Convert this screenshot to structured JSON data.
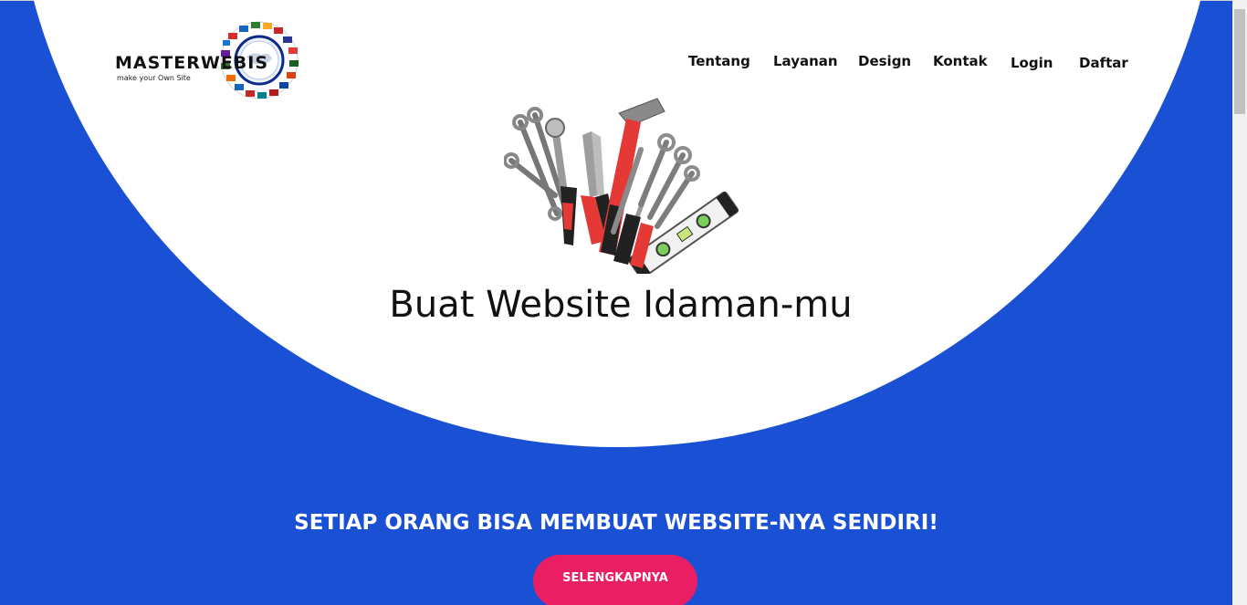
{
  "brand": {
    "name": "MASTERWEBIS",
    "tagline": "make your Own Site"
  },
  "nav": {
    "items": [
      {
        "label": "Tentang"
      },
      {
        "label": "Layanan"
      },
      {
        "label": "Design"
      },
      {
        "label": "Kontak"
      },
      {
        "label": "Login"
      },
      {
        "label": "Daftar"
      }
    ]
  },
  "hero": {
    "title": "Buat Website Idaman-mu",
    "image_icon": "tools-icon"
  },
  "section": {
    "heading": "SETIAP ORANG BISA MEMBUAT WEBSITE-NYA SENDIRI!",
    "cta_label": "SELENGKAPNYA"
  },
  "colors": {
    "background": "#1a50d4",
    "hero_circle": "#ffffff",
    "accent": "#e91e63"
  }
}
